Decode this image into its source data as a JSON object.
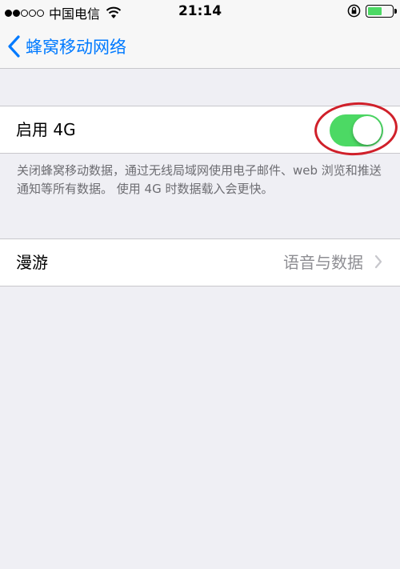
{
  "status_bar": {
    "signal_strength_filled": 2,
    "signal_strength_total": 5,
    "carrier": "中国电信",
    "time": "21:14",
    "battery_level": 0.6,
    "icons": [
      "signal-dots-icon",
      "wifi-icon",
      "rotation-lock-icon",
      "battery-icon"
    ]
  },
  "nav": {
    "back_label": "蜂窝移动网络",
    "back_icon": "chevron-left-icon"
  },
  "settings": {
    "enable_4g": {
      "label": "启用 4G",
      "enabled": true
    },
    "footer_note": "关闭蜂窝移动数据，通过无线局域网使用电子邮件、web 浏览和推送通知等所有数据。 使用 4G 时数据载入会更快。",
    "roaming": {
      "label": "漫游",
      "value": "语音与数据",
      "disclosure_icon": "chevron-right-icon"
    }
  },
  "colors": {
    "accent": "#007aff",
    "toggle_on": "#4cd964",
    "annotation": "#d0202a",
    "background": "#efeff4",
    "secondary_text": "#8e8e93"
  }
}
